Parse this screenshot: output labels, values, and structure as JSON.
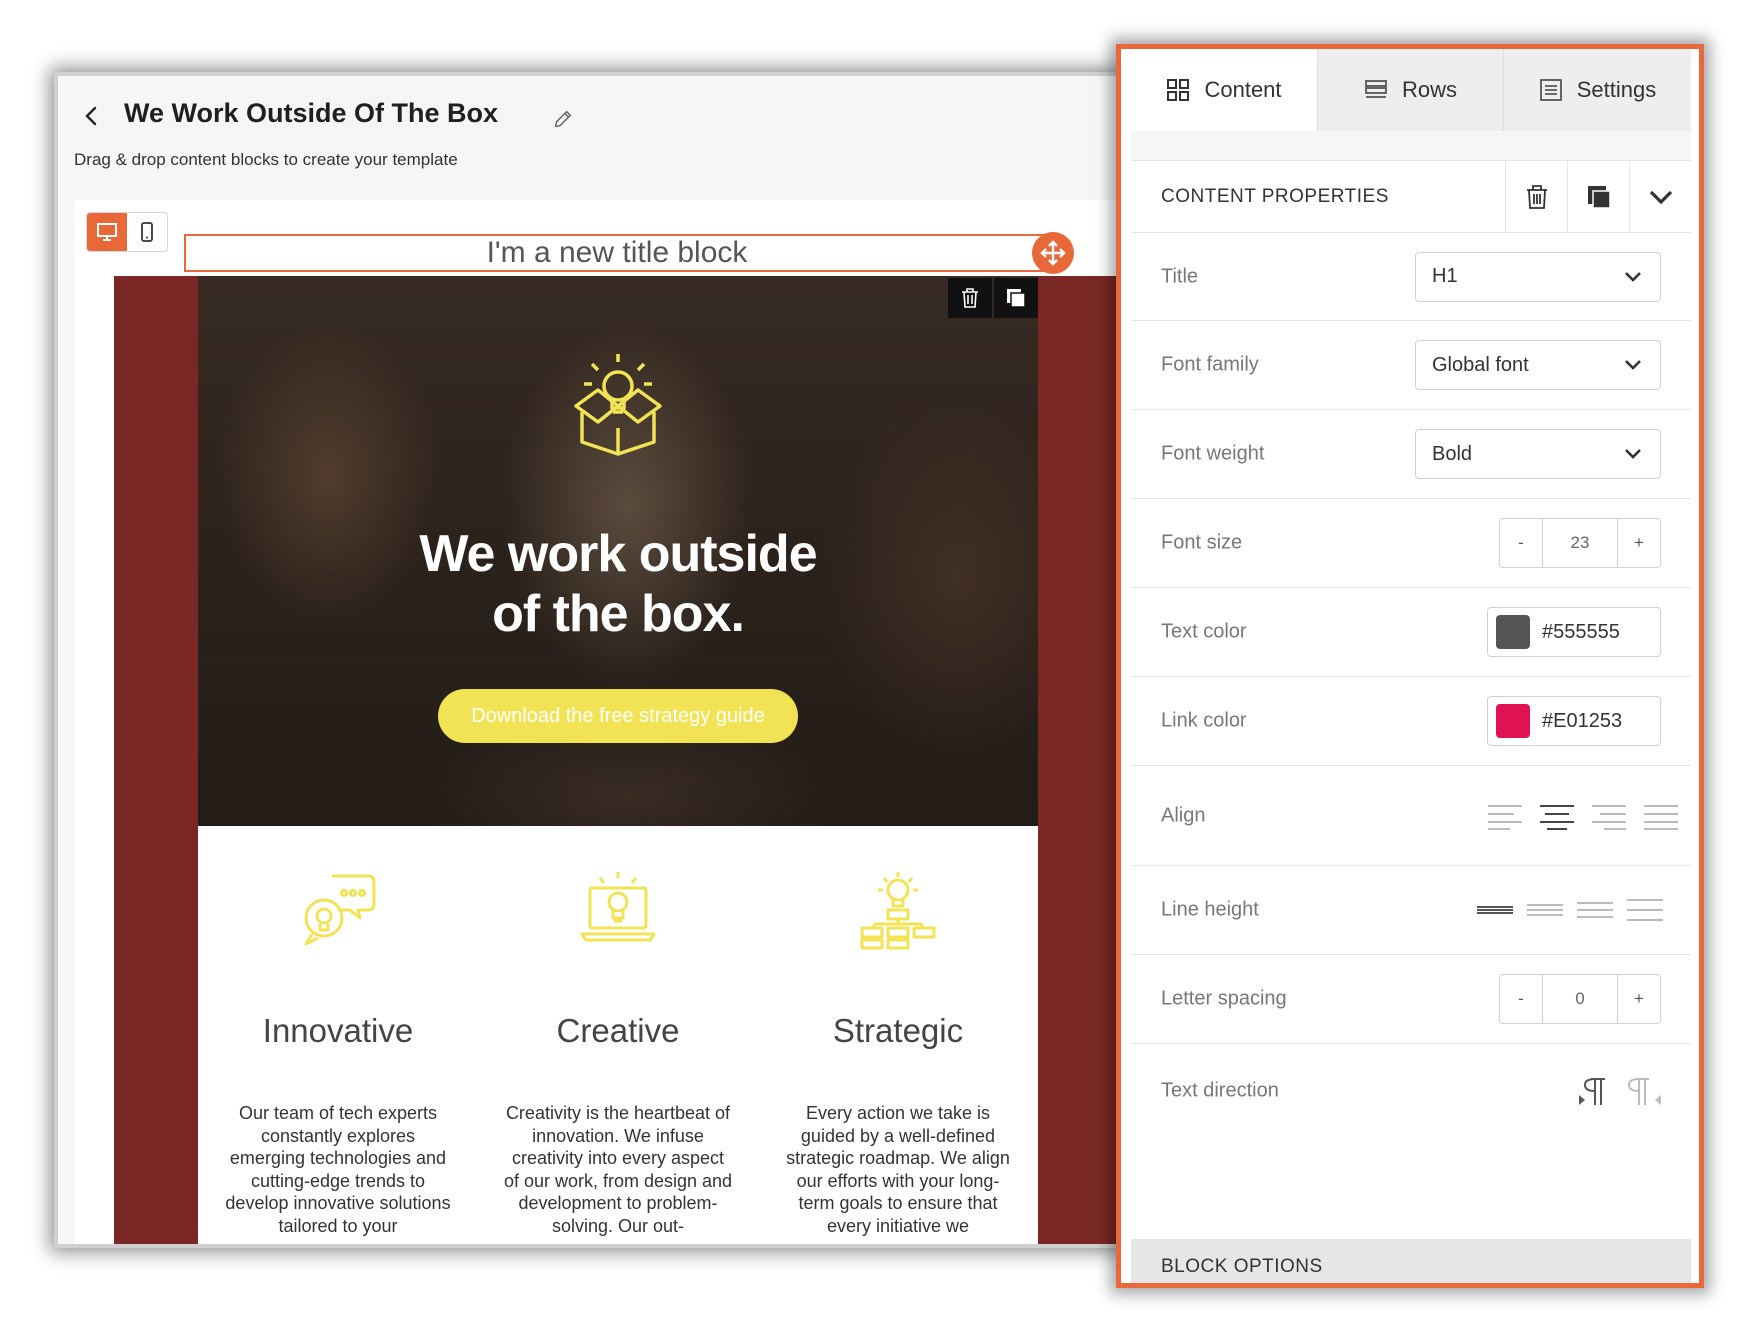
{
  "editor": {
    "title": "We Work Outside Of The Box",
    "subtitle": "Drag & drop content blocks to create your template",
    "title_block_text": "I'm a new title block",
    "hero": {
      "heading_line1": "We work outside",
      "heading_line2": "of the box.",
      "button_label": "Download the free strategy guide"
    },
    "features": [
      {
        "title": "Innovative",
        "icon": "chat-bubbles-lightbulb-icon",
        "text": "Our team of tech experts constantly explores emerging technologies and cutting-edge trends to develop innovative solutions tailored to your"
      },
      {
        "title": "Creative",
        "icon": "laptop-lightbulb-icon",
        "text": "Creativity is the heartbeat of innovation. We infuse creativity into every aspect of our work, from design and development to problem-solving. Our out-"
      },
      {
        "title": "Strategic",
        "icon": "lightbulb-flowchart-icon",
        "text": "Every action we take is guided by a well-defined strategic roadmap. We align our efforts with your long-term goals to ensure that every initiative we"
      }
    ]
  },
  "panel": {
    "tabs": [
      {
        "label": "Content",
        "icon": "grid-icon",
        "active": true
      },
      {
        "label": "Rows",
        "icon": "rows-icon",
        "active": false
      },
      {
        "label": "Settings",
        "icon": "settings-list-icon",
        "active": false
      }
    ],
    "section_title": "CONTENT PROPERTIES",
    "title": {
      "label": "Title",
      "value": "H1"
    },
    "font_family": {
      "label": "Font family",
      "value": "Global font"
    },
    "font_weight": {
      "label": "Font weight",
      "value": "Bold"
    },
    "font_size": {
      "label": "Font size",
      "value": "23",
      "minus": "-",
      "plus": "+"
    },
    "text_color": {
      "label": "Text color",
      "value": "#555555"
    },
    "link_color": {
      "label": "Link color",
      "value": "#E01253"
    },
    "align": {
      "label": "Align"
    },
    "line_height": {
      "label": "Line height"
    },
    "letter_spacing": {
      "label": "Letter spacing",
      "value": "0",
      "minus": "-",
      "plus": "+"
    },
    "text_direction": {
      "label": "Text direction"
    },
    "block_options": "BLOCK OPTIONS"
  },
  "colors": {
    "accent": "#E8683A",
    "hero_bg": "#7A2826",
    "icon_yellow": "#F2E354"
  }
}
